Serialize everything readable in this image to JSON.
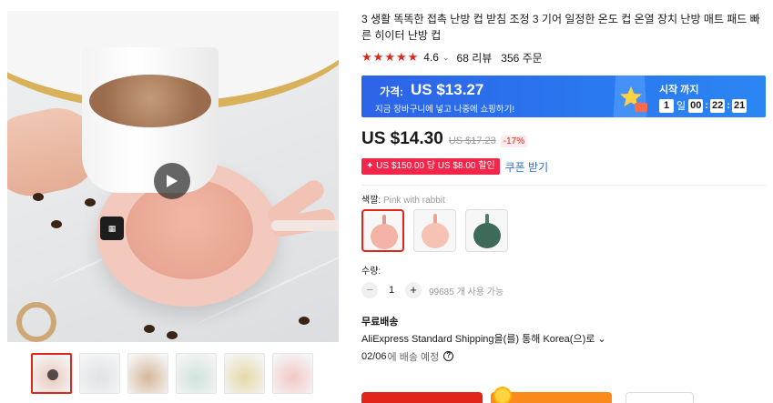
{
  "product": {
    "title": "3 생활 똑똑한 접촉 난방 컵 받침 조정 3 기어 일정한 온도 컵 온열 장치 난방 매트 패드 빠른 히이터 난방 컵",
    "rating": "4.6",
    "reviews": "68 리뷰",
    "orders": "356 주문",
    "stars": 5
  },
  "promo_banner": {
    "price_label": "가격:",
    "price": "US $13.27",
    "subtitle": "지금 장바구니에 넣고 나중에 쇼핑하기!",
    "countdown_label": "시작 까지",
    "days": "1",
    "days_unit": "일",
    "hours": "00",
    "minutes": "22",
    "seconds": "21",
    "colors": {
      "start": "#2d63e8",
      "end": "#2b86f3"
    }
  },
  "pricing": {
    "current": "US $14.30",
    "original": "US $17.23",
    "discount": "-17%"
  },
  "coupon": {
    "tag": "US $150.00 당 US $8.00 할인",
    "link": "쿠폰 받기"
  },
  "color": {
    "label": "색깔:",
    "selected": "Pink with rabbit",
    "options": [
      {
        "name": "pink-rabbit",
        "disc": "#f4b3a4",
        "handle": "#d89b8d"
      },
      {
        "name": "pink",
        "disc": "#f6c2b4",
        "handle": "#e8a595"
      },
      {
        "name": "green",
        "disc": "#3e6a59",
        "handle": "#4f7f6c"
      }
    ]
  },
  "quantity": {
    "label": "수량:",
    "minus": "−",
    "value": "1",
    "plus": "+",
    "stock": "99685 개 사용 가능"
  },
  "shipping": {
    "title": "무료배송",
    "method": "AliExpress Standard Shipping을(를) 통해 Korea(으)로 ⌄",
    "date": "02/06",
    "date_note": "에 배송 예정",
    "help": "?"
  },
  "gallery": {
    "thumbnails": [
      {
        "name": "thumb-video",
        "bg": "#e9c9bd",
        "has_play": true
      },
      {
        "name": "thumb-2",
        "bg": "#dfe3e6",
        "has_play": false
      },
      {
        "name": "thumb-3",
        "bg": "#d7b79a",
        "has_play": false
      },
      {
        "name": "thumb-4",
        "bg": "#cfe3dc",
        "has_play": false
      },
      {
        "name": "thumb-5",
        "bg": "#e6d9a6",
        "has_play": false
      },
      {
        "name": "thumb-6",
        "bg": "#f3c8c4",
        "has_play": false
      }
    ]
  },
  "theme": {
    "accent": "#e1251b",
    "link": "#2e6fd6",
    "coupon": "#f2264a",
    "cart": "#fa8a1c"
  }
}
